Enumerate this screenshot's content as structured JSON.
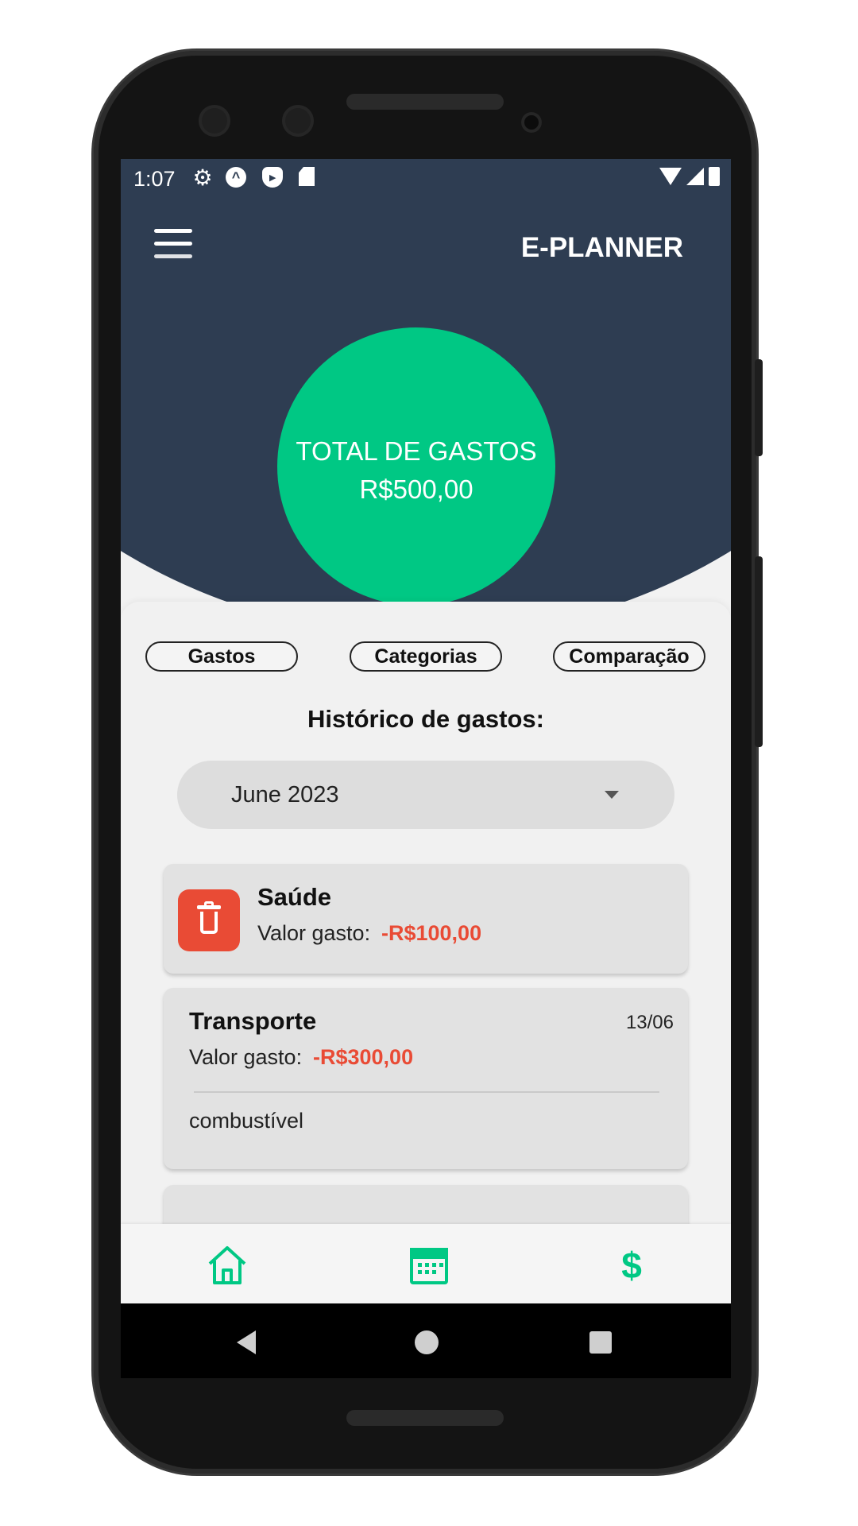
{
  "status_bar": {
    "time": "1:07"
  },
  "header": {
    "title": "E-PLANNER"
  },
  "summary": {
    "label": "TOTAL DE GASTOS",
    "amount": "R$500,00"
  },
  "tabs": [
    {
      "label": "Gastos"
    },
    {
      "label": "Categorias"
    },
    {
      "label": "Comparação"
    }
  ],
  "history": {
    "title": "Histórico de gastos:",
    "month_selected": "June 2023",
    "items": [
      {
        "category": "Saúde",
        "value_label": "Valor gasto:",
        "value": "-R$100,00"
      },
      {
        "category": "Transporte",
        "date": "13/06",
        "value_label": "Valor gasto:",
        "value": "-R$300,00",
        "note": "combustível"
      }
    ]
  },
  "bottom_nav": {
    "money_symbol": "$"
  },
  "colors": {
    "header_bg": "#2e3d52",
    "accent_green": "#00c884",
    "negative_red": "#e94b35",
    "card_bg": "#e2e2e2"
  },
  "icons": [
    "menu-icon",
    "settings-icon",
    "trash-icon",
    "home-icon",
    "calendar-icon",
    "dollar-icon",
    "dropdown-caret-icon"
  ]
}
